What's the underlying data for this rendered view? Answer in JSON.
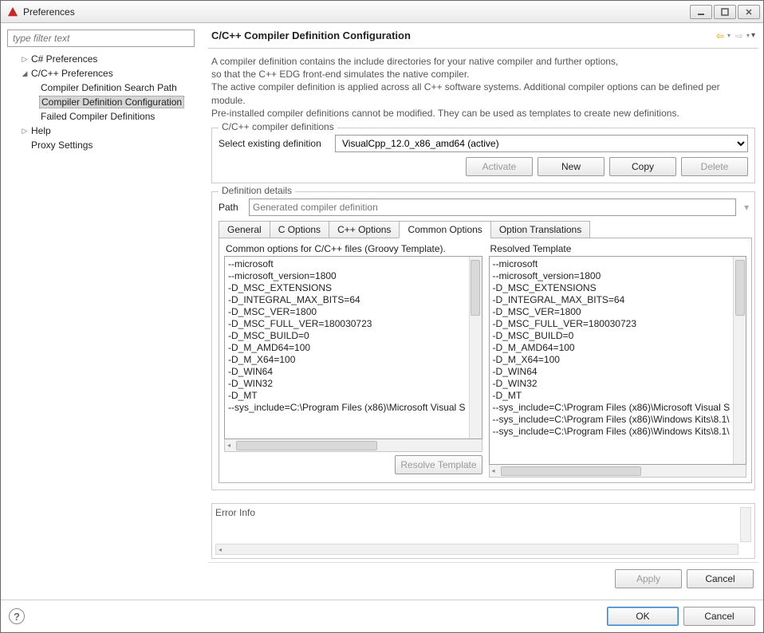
{
  "window": {
    "title": "Preferences"
  },
  "filter": {
    "placeholder": "type filter text"
  },
  "tree": {
    "csharp": "C# Preferences",
    "ccpp": "C/C++ Preferences",
    "ccpp_children": {
      "search_path": "Compiler Definition Search Path",
      "config": "Compiler Definition Configuration",
      "failed": "Failed Compiler Definitions"
    },
    "help": "Help",
    "proxy": "Proxy Settings"
  },
  "header": {
    "title": "C/C++ Compiler Definition Configuration"
  },
  "description": {
    "l1": "A compiler definition contains the include directories for your native compiler and further options,",
    "l2": "so that the C++ EDG front-end simulates the native compiler.",
    "l3": "The active compiler definition is applied across all C++ software systems. Additional compiler options can be defined per module.",
    "l4": "Pre-installed compiler definitions cannot be modified. They can be used as templates to create new definitions."
  },
  "defs_group": {
    "legend": "C/C++ compiler definitions",
    "select_label": "Select existing definition",
    "selected": "VisualCpp_12.0_x86_amd64 (active)",
    "activate": "Activate",
    "new": "New",
    "copy": "Copy",
    "delete": "Delete"
  },
  "details_group": {
    "legend": "Definition details",
    "path_label": "Path",
    "path_value": "Generated compiler definition"
  },
  "tabs": {
    "general": "General",
    "c_options": "C Options",
    "cpp_options": "C++ Options",
    "common_options": "Common Options",
    "option_translations": "Option Translations"
  },
  "common_pane": {
    "left_title": "Common options for C/C++ files (Groovy Template).",
    "right_title": "Resolved Template",
    "left_lines": [
      "--microsoft",
      "--microsoft_version=1800",
      "-D_MSC_EXTENSIONS",
      "-D_INTEGRAL_MAX_BITS=64",
      "-D_MSC_VER=1800",
      "-D_MSC_FULL_VER=180030723",
      "-D_MSC_BUILD=0",
      "-D_M_AMD64=100",
      "-D_M_X64=100",
      "-D_WIN64",
      "-D_WIN32",
      "-D_MT",
      "--sys_include=C:\\Program Files (x86)\\Microsoft Visual S"
    ],
    "right_lines": [
      "--microsoft",
      "--microsoft_version=1800",
      "-D_MSC_EXTENSIONS",
      "-D_INTEGRAL_MAX_BITS=64",
      "-D_MSC_VER=1800",
      "-D_MSC_FULL_VER=180030723",
      "-D_MSC_BUILD=0",
      "-D_M_AMD64=100",
      "-D_M_X64=100",
      "-D_WIN64",
      "-D_WIN32",
      "-D_MT",
      "--sys_include=C:\\Program Files (x86)\\Microsoft Visual S",
      "--sys_include=C:\\Program Files (x86)\\Windows Kits\\8.1\\",
      "--sys_include=C:\\Program Files (x86)\\Windows Kits\\8.1\\"
    ],
    "resolve_btn": "Resolve Template"
  },
  "error": {
    "label": "Error Info"
  },
  "actions": {
    "apply": "Apply",
    "cancel": "Cancel"
  },
  "footer": {
    "ok": "OK",
    "cancel": "Cancel"
  }
}
